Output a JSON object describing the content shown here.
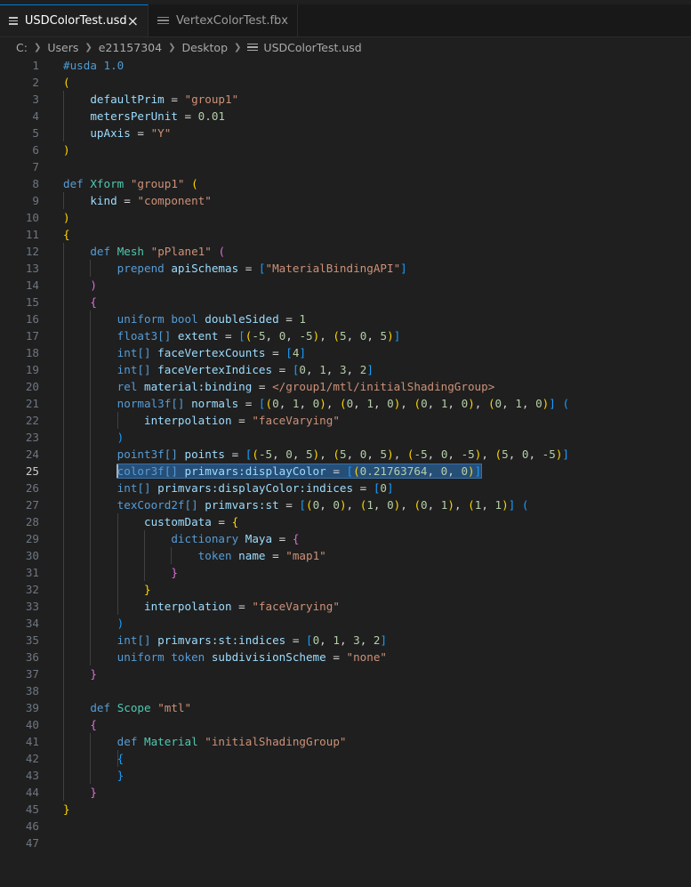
{
  "tabs": [
    {
      "label": "USDColorTest.usd",
      "active": true,
      "close": "×"
    },
    {
      "label": "VertexColorTest.fbx",
      "active": false
    }
  ],
  "breadcrumb": [
    "C:",
    "Users",
    "e21157304",
    "Desktop",
    "USDColorTest.usd"
  ],
  "editor": {
    "cursor_line": 25,
    "lines": [
      [
        [
          "sh",
          "#usda 1.0"
        ]
      ],
      [
        [
          "b1",
          "("
        ]
      ],
      [
        [
          "pu",
          "    "
        ],
        [
          "ns",
          "defaultPrim"
        ],
        [
          "pu",
          " = "
        ],
        [
          "st",
          "\"group1\""
        ]
      ],
      [
        [
          "pu",
          "    "
        ],
        [
          "ns",
          "metersPerUnit"
        ],
        [
          "pu",
          " = "
        ],
        [
          "nu",
          "0.01"
        ]
      ],
      [
        [
          "pu",
          "    "
        ],
        [
          "ns",
          "upAxis"
        ],
        [
          "pu",
          " = "
        ],
        [
          "st",
          "\"Y\""
        ]
      ],
      [
        [
          "b1",
          ")"
        ]
      ],
      [],
      [
        [
          "kw",
          "def "
        ],
        [
          "ty",
          "Xform "
        ],
        [
          "st",
          "\"group1\" "
        ],
        [
          "b1",
          "("
        ]
      ],
      [
        [
          "pu",
          "    "
        ],
        [
          "ns",
          "kind"
        ],
        [
          "pu",
          " = "
        ],
        [
          "st",
          "\"component\""
        ]
      ],
      [
        [
          "b1",
          ")"
        ]
      ],
      [
        [
          "b1",
          "{"
        ]
      ],
      [
        [
          "pu",
          "    "
        ],
        [
          "kw",
          "def "
        ],
        [
          "ty",
          "Mesh "
        ],
        [
          "st",
          "\"pPlane1\" "
        ],
        [
          "b2",
          "("
        ]
      ],
      [
        [
          "pu",
          "        "
        ],
        [
          "kw",
          "prepend "
        ],
        [
          "ns",
          "apiSchemas"
        ],
        [
          "pu",
          " = "
        ],
        [
          "b3",
          "["
        ],
        [
          "st",
          "\"MaterialBindingAPI\""
        ],
        [
          "b3",
          "]"
        ]
      ],
      [
        [
          "pu",
          "    "
        ],
        [
          "b2",
          ")"
        ]
      ],
      [
        [
          "pu",
          "    "
        ],
        [
          "b2",
          "{"
        ]
      ],
      [
        [
          "pu",
          "        "
        ],
        [
          "kw",
          "uniform bool "
        ],
        [
          "ns",
          "doubleSided"
        ],
        [
          "pu",
          " = "
        ],
        [
          "nu",
          "1"
        ]
      ],
      [
        [
          "pu",
          "        "
        ],
        [
          "kw",
          "float3[] "
        ],
        [
          "ns",
          "extent"
        ],
        [
          "pu",
          " = "
        ],
        [
          "b3",
          "["
        ],
        [
          "b1",
          "("
        ],
        [
          "nu",
          "-5"
        ],
        [
          "pu",
          ", "
        ],
        [
          "nu",
          "0"
        ],
        [
          "pu",
          ", "
        ],
        [
          "nu",
          "-5"
        ],
        [
          "b1",
          ")"
        ],
        [
          "pu",
          ", "
        ],
        [
          "b1",
          "("
        ],
        [
          "nu",
          "5"
        ],
        [
          "pu",
          ", "
        ],
        [
          "nu",
          "0"
        ],
        [
          "pu",
          ", "
        ],
        [
          "nu",
          "5"
        ],
        [
          "b1",
          ")"
        ],
        [
          "b3",
          "]"
        ]
      ],
      [
        [
          "pu",
          "        "
        ],
        [
          "kw",
          "int[] "
        ],
        [
          "ns",
          "faceVertexCounts"
        ],
        [
          "pu",
          " = "
        ],
        [
          "b3",
          "["
        ],
        [
          "nu",
          "4"
        ],
        [
          "b3",
          "]"
        ]
      ],
      [
        [
          "pu",
          "        "
        ],
        [
          "kw",
          "int[] "
        ],
        [
          "ns",
          "faceVertexIndices"
        ],
        [
          "pu",
          " = "
        ],
        [
          "b3",
          "["
        ],
        [
          "nu",
          "0"
        ],
        [
          "pu",
          ", "
        ],
        [
          "nu",
          "1"
        ],
        [
          "pu",
          ", "
        ],
        [
          "nu",
          "3"
        ],
        [
          "pu",
          ", "
        ],
        [
          "nu",
          "2"
        ],
        [
          "b3",
          "]"
        ]
      ],
      [
        [
          "pu",
          "        "
        ],
        [
          "kw",
          "rel "
        ],
        [
          "ns",
          "material:binding"
        ],
        [
          "pu",
          " = "
        ],
        [
          "st",
          "</group1/mtl/initialShadingGroup>"
        ]
      ],
      [
        [
          "pu",
          "        "
        ],
        [
          "kw",
          "normal3f[] "
        ],
        [
          "ns",
          "normals"
        ],
        [
          "pu",
          " = "
        ],
        [
          "b3",
          "["
        ],
        [
          "b1",
          "("
        ],
        [
          "nu",
          "0"
        ],
        [
          "pu",
          ", "
        ],
        [
          "nu",
          "1"
        ],
        [
          "pu",
          ", "
        ],
        [
          "nu",
          "0"
        ],
        [
          "b1",
          ")"
        ],
        [
          "pu",
          ", "
        ],
        [
          "b1",
          "("
        ],
        [
          "nu",
          "0"
        ],
        [
          "pu",
          ", "
        ],
        [
          "nu",
          "1"
        ],
        [
          "pu",
          ", "
        ],
        [
          "nu",
          "0"
        ],
        [
          "b1",
          ")"
        ],
        [
          "pu",
          ", "
        ],
        [
          "b1",
          "("
        ],
        [
          "nu",
          "0"
        ],
        [
          "pu",
          ", "
        ],
        [
          "nu",
          "1"
        ],
        [
          "pu",
          ", "
        ],
        [
          "nu",
          "0"
        ],
        [
          "b1",
          ")"
        ],
        [
          "pu",
          ", "
        ],
        [
          "b1",
          "("
        ],
        [
          "nu",
          "0"
        ],
        [
          "pu",
          ", "
        ],
        [
          "nu",
          "1"
        ],
        [
          "pu",
          ", "
        ],
        [
          "nu",
          "0"
        ],
        [
          "b1",
          ")"
        ],
        [
          "b3",
          "]"
        ],
        [
          "pu",
          " "
        ],
        [
          "b3",
          "("
        ]
      ],
      [
        [
          "pu",
          "            "
        ],
        [
          "ns",
          "interpolation"
        ],
        [
          "pu",
          " = "
        ],
        [
          "st",
          "\"faceVarying\""
        ]
      ],
      [
        [
          "pu",
          "        "
        ],
        [
          "b3",
          ")"
        ]
      ],
      [
        [
          "pu",
          "        "
        ],
        [
          "kw",
          "point3f[] "
        ],
        [
          "ns",
          "points"
        ],
        [
          "pu",
          " = "
        ],
        [
          "b3",
          "["
        ],
        [
          "b1",
          "("
        ],
        [
          "nu",
          "-5"
        ],
        [
          "pu",
          ", "
        ],
        [
          "nu",
          "0"
        ],
        [
          "pu",
          ", "
        ],
        [
          "nu",
          "5"
        ],
        [
          "b1",
          ")"
        ],
        [
          "pu",
          ", "
        ],
        [
          "b1",
          "("
        ],
        [
          "nu",
          "5"
        ],
        [
          "pu",
          ", "
        ],
        [
          "nu",
          "0"
        ],
        [
          "pu",
          ", "
        ],
        [
          "nu",
          "5"
        ],
        [
          "b1",
          ")"
        ],
        [
          "pu",
          ", "
        ],
        [
          "b1",
          "("
        ],
        [
          "nu",
          "-5"
        ],
        [
          "pu",
          ", "
        ],
        [
          "nu",
          "0"
        ],
        [
          "pu",
          ", "
        ],
        [
          "nu",
          "-5"
        ],
        [
          "b1",
          ")"
        ],
        [
          "pu",
          ", "
        ],
        [
          "b1",
          "("
        ],
        [
          "nu",
          "5"
        ],
        [
          "pu",
          ", "
        ],
        [
          "nu",
          "0"
        ],
        [
          "pu",
          ", "
        ],
        [
          "nu",
          "-5"
        ],
        [
          "b1",
          ")"
        ],
        [
          "b3",
          "]"
        ]
      ],
      [
        [
          "pu",
          "        "
        ],
        [
          "kw",
          "color3f[] "
        ],
        [
          "ns",
          "primvars:displayColor"
        ],
        [
          "pu",
          " = "
        ],
        [
          "b3",
          "["
        ],
        [
          "b1",
          "("
        ],
        [
          "nu",
          "0.21763764"
        ],
        [
          "pu",
          ", "
        ],
        [
          "nu",
          "0"
        ],
        [
          "pu",
          ", "
        ],
        [
          "nu",
          "0"
        ],
        [
          "b1",
          ")"
        ],
        [
          "b3",
          "]"
        ]
      ],
      [
        [
          "pu",
          "        "
        ],
        [
          "kw",
          "int[] "
        ],
        [
          "ns",
          "primvars:displayColor:indices"
        ],
        [
          "pu",
          " = "
        ],
        [
          "b3",
          "["
        ],
        [
          "nu",
          "0"
        ],
        [
          "b3",
          "]"
        ]
      ],
      [
        [
          "pu",
          "        "
        ],
        [
          "kw",
          "texCoord2f[] "
        ],
        [
          "ns",
          "primvars:st"
        ],
        [
          "pu",
          " = "
        ],
        [
          "b3",
          "["
        ],
        [
          "b1",
          "("
        ],
        [
          "nu",
          "0"
        ],
        [
          "pu",
          ", "
        ],
        [
          "nu",
          "0"
        ],
        [
          "b1",
          ")"
        ],
        [
          "pu",
          ", "
        ],
        [
          "b1",
          "("
        ],
        [
          "nu",
          "1"
        ],
        [
          "pu",
          ", "
        ],
        [
          "nu",
          "0"
        ],
        [
          "b1",
          ")"
        ],
        [
          "pu",
          ", "
        ],
        [
          "b1",
          "("
        ],
        [
          "nu",
          "0"
        ],
        [
          "pu",
          ", "
        ],
        [
          "nu",
          "1"
        ],
        [
          "b1",
          ")"
        ],
        [
          "pu",
          ", "
        ],
        [
          "b1",
          "("
        ],
        [
          "nu",
          "1"
        ],
        [
          "pu",
          ", "
        ],
        [
          "nu",
          "1"
        ],
        [
          "b1",
          ")"
        ],
        [
          "b3",
          "]"
        ],
        [
          "pu",
          " "
        ],
        [
          "b3",
          "("
        ]
      ],
      [
        [
          "pu",
          "            "
        ],
        [
          "ns",
          "customData"
        ],
        [
          "pu",
          " = "
        ],
        [
          "b1",
          "{"
        ]
      ],
      [
        [
          "pu",
          "                "
        ],
        [
          "kw",
          "dictionary "
        ],
        [
          "ns",
          "Maya"
        ],
        [
          "pu",
          " = "
        ],
        [
          "b2",
          "{"
        ]
      ],
      [
        [
          "pu",
          "                    "
        ],
        [
          "kw",
          "token "
        ],
        [
          "ns",
          "name"
        ],
        [
          "pu",
          " = "
        ],
        [
          "st",
          "\"map1\""
        ]
      ],
      [
        [
          "pu",
          "                "
        ],
        [
          "b2",
          "}"
        ]
      ],
      [
        [
          "pu",
          "            "
        ],
        [
          "b1",
          "}"
        ]
      ],
      [
        [
          "pu",
          "            "
        ],
        [
          "ns",
          "interpolation"
        ],
        [
          "pu",
          " = "
        ],
        [
          "st",
          "\"faceVarying\""
        ]
      ],
      [
        [
          "pu",
          "        "
        ],
        [
          "b3",
          ")"
        ]
      ],
      [
        [
          "pu",
          "        "
        ],
        [
          "kw",
          "int[] "
        ],
        [
          "ns",
          "primvars:st:indices"
        ],
        [
          "pu",
          " = "
        ],
        [
          "b3",
          "["
        ],
        [
          "nu",
          "0"
        ],
        [
          "pu",
          ", "
        ],
        [
          "nu",
          "1"
        ],
        [
          "pu",
          ", "
        ],
        [
          "nu",
          "3"
        ],
        [
          "pu",
          ", "
        ],
        [
          "nu",
          "2"
        ],
        [
          "b3",
          "]"
        ]
      ],
      [
        [
          "pu",
          "        "
        ],
        [
          "kw",
          "uniform token "
        ],
        [
          "ns",
          "subdivisionScheme"
        ],
        [
          "pu",
          " = "
        ],
        [
          "st",
          "\"none\""
        ]
      ],
      [
        [
          "pu",
          "    "
        ],
        [
          "b2",
          "}"
        ]
      ],
      [],
      [
        [
          "pu",
          "    "
        ],
        [
          "kw",
          "def "
        ],
        [
          "ty",
          "Scope "
        ],
        [
          "st",
          "\"mtl\""
        ]
      ],
      [
        [
          "pu",
          "    "
        ],
        [
          "b2",
          "{"
        ]
      ],
      [
        [
          "pu",
          "        "
        ],
        [
          "kw",
          "def "
        ],
        [
          "ty",
          "Material "
        ],
        [
          "st",
          "\"initialShadingGroup\""
        ]
      ],
      [
        [
          "pu",
          "        "
        ],
        [
          "b3",
          "{"
        ]
      ],
      [
        [
          "pu",
          "        "
        ],
        [
          "b3",
          "}"
        ]
      ],
      [
        [
          "pu",
          "    "
        ],
        [
          "b2",
          "}"
        ]
      ],
      [
        [
          "b1",
          "}"
        ]
      ],
      [],
      []
    ]
  }
}
